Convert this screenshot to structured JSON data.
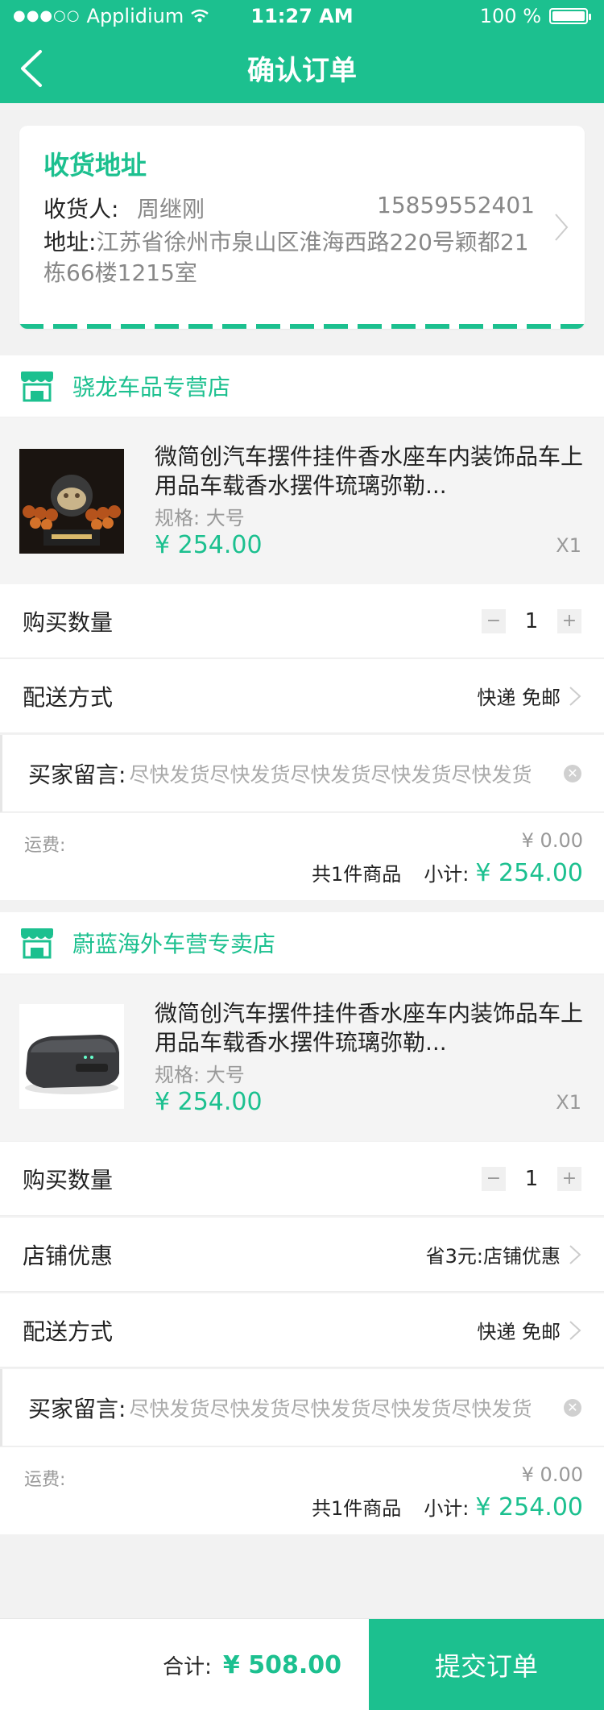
{
  "status_bar": {
    "carrier": "Applidium",
    "time": "11:27 AM",
    "battery": "100 %"
  },
  "nav": {
    "title": "确认订单"
  },
  "address": {
    "heading": "收货地址",
    "receiver_label": "收货人:",
    "receiver_name": "周继刚",
    "phone": "15859552401",
    "address_label": "地址:",
    "address_text": "江苏省徐州市泉山区淮海西路220号颖都21栋66楼1215室"
  },
  "stores": [
    {
      "name": "骁龙车品专营店",
      "product": {
        "title": "微简创汽车摆件挂件香水座车内装饰品车上用品车载香水摆件琉璃弥勒...",
        "spec": "规格: 大号",
        "price": "¥ 254.00",
        "qty": "X1"
      },
      "quantity_label": "购买数量",
      "quantity_value": "1",
      "delivery_label": "配送方式",
      "delivery_value": "快递 免邮",
      "message_label": "买家留言:",
      "message_text": "尽快发货尽快发货尽快发货尽快发货尽快发货",
      "fee_label": "运费:",
      "fee_value": "¥ 0.00",
      "count_text": "共1件商品",
      "subtotal_label": "小计:",
      "subtotal_value": "¥ 254.00"
    },
    {
      "name": "蔚蓝海外车营专卖店",
      "product": {
        "title": "微简创汽车摆件挂件香水座车内装饰品车上用品车载香水摆件琉璃弥勒...",
        "spec": "规格: 大号",
        "price": "¥ 254.00",
        "qty": "X1"
      },
      "quantity_label": "购买数量",
      "quantity_value": "1",
      "discount_label": "店铺优惠",
      "discount_value": "省3元:店铺优惠",
      "delivery_label": "配送方式",
      "delivery_value": "快递 免邮",
      "message_label": "买家留言:",
      "message_text": "尽快发货尽快发货尽快发货尽快发货尽快发货",
      "fee_label": "运费:",
      "fee_value": "¥ 0.00",
      "count_text": "共1件商品",
      "subtotal_label": "小计:",
      "subtotal_value": "¥ 254.00"
    }
  ],
  "bottom": {
    "total_label": "合计:",
    "total_value": "¥ 508.00",
    "submit_label": "提交订单"
  },
  "stepper": {
    "minus": "−",
    "plus": "+"
  },
  "colors": {
    "accent": "#1cc08f"
  }
}
